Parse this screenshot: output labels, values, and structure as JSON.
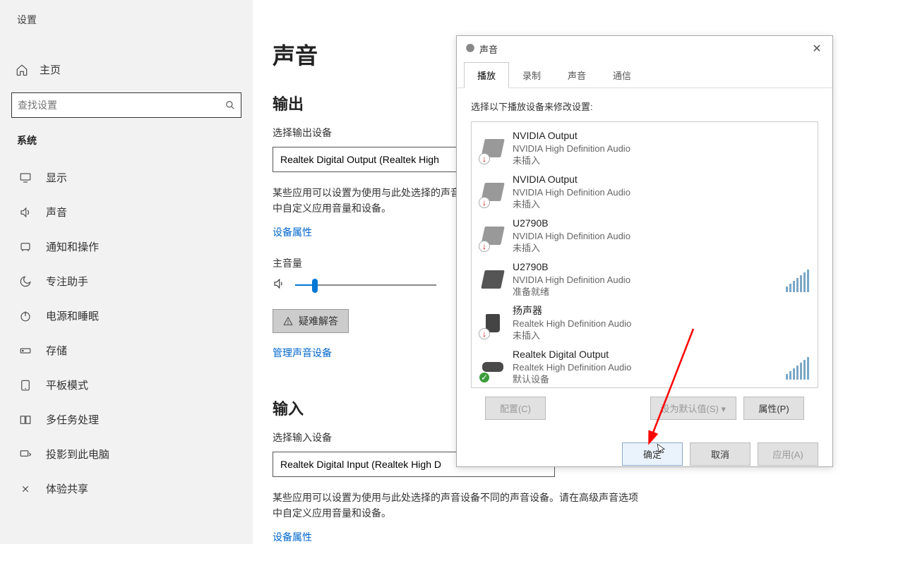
{
  "sidebar": {
    "app_title": "设置",
    "home_label": "主页",
    "search_placeholder": "查找设置",
    "category": "系统",
    "items": [
      {
        "icon": "display",
        "label": "显示"
      },
      {
        "icon": "sound",
        "label": "声音"
      },
      {
        "icon": "notify",
        "label": "通知和操作"
      },
      {
        "icon": "focus",
        "label": "专注助手"
      },
      {
        "icon": "power",
        "label": "电源和睡眠"
      },
      {
        "icon": "storage",
        "label": "存储"
      },
      {
        "icon": "tablet",
        "label": "平板模式"
      },
      {
        "icon": "multitask",
        "label": "多任务处理"
      },
      {
        "icon": "project",
        "label": "投影到此电脑"
      },
      {
        "icon": "share",
        "label": "体验共享"
      }
    ]
  },
  "main": {
    "page_title": "声音",
    "output_section": "输出",
    "output_select_label": "选择输出设备",
    "output_select_value": "Realtek Digital Output (Realtek High",
    "output_desc": "某些应用可以设置为使用与此处选择的声音设备不同的声音设备。请在高级声音选项中自定义应用音量和设备。",
    "device_props_link": "设备属性",
    "volume_label": "主音量",
    "troubleshoot_label": "疑难解答",
    "manage_link": "管理声音设备",
    "input_section": "输入",
    "input_select_label": "选择输入设备",
    "input_select_value": "Realtek Digital Input (Realtek High D",
    "input_desc": "某些应用可以设置为使用与此处选择的声音设备不同的声音设备。请在高级声音选项中自定义应用音量和设备。",
    "device_props_link2": "设备属性"
  },
  "dialog": {
    "title": "声音",
    "tabs": [
      "播放",
      "录制",
      "声音",
      "通信"
    ],
    "active_tab": 0,
    "instruction": "选择以下播放设备来修改设置:",
    "devices": [
      {
        "name": "NVIDIA Output",
        "driver": "NVIDIA High Definition Audio",
        "status": "未插入",
        "badge": "down",
        "icon": "monitor"
      },
      {
        "name": "NVIDIA Output",
        "driver": "NVIDIA High Definition Audio",
        "status": "未插入",
        "badge": "down",
        "icon": "monitor"
      },
      {
        "name": "U2790B",
        "driver": "NVIDIA High Definition Audio",
        "status": "未插入",
        "badge": "down",
        "icon": "monitor"
      },
      {
        "name": "U2790B",
        "driver": "NVIDIA High Definition Audio",
        "status": "准备就绪",
        "badge": "",
        "icon": "monitor-dark",
        "level": true
      },
      {
        "name": "扬声器",
        "driver": "Realtek High Definition Audio",
        "status": "未插入",
        "badge": "down",
        "icon": "speaker"
      },
      {
        "name": "Realtek Digital Output",
        "driver": "Realtek High Definition Audio",
        "status": "默认设备",
        "badge": "check",
        "icon": "digital",
        "level": true
      }
    ],
    "btn_configure": "配置(C)",
    "btn_default": "设为默认值(S)",
    "btn_properties": "属性(P)",
    "btn_ok": "确定",
    "btn_cancel": "取消",
    "btn_apply": "应用(A)"
  }
}
